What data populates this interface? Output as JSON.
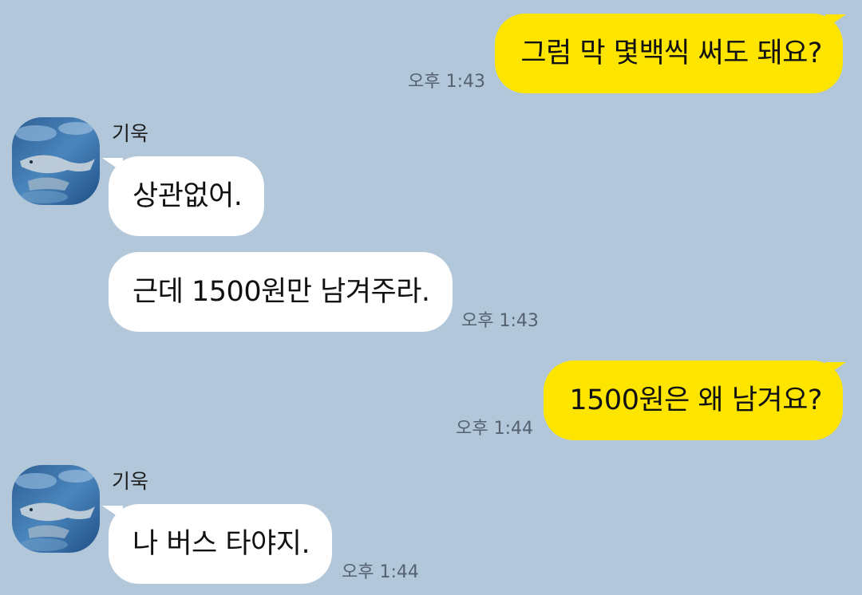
{
  "conversation": {
    "messages": [
      {
        "text": "그럼 막 몇백씩 써도 돼요?",
        "time": "오후 1:43"
      },
      {
        "sender": "기욱",
        "text": "상관없어."
      },
      {
        "text": "근데 1500원만 남겨주라.",
        "time": "오후 1:43"
      },
      {
        "text": "1500원은 왜 남겨요?",
        "time": "오후 1:44"
      },
      {
        "sender": "기욱",
        "text": "나 버스 타야지.",
        "time": "오후 1:44"
      }
    ]
  },
  "colors": {
    "background": "#b2c7d9",
    "outgoing_bubble": "#fee500",
    "incoming_bubble": "#ffffff",
    "timestamp": "#556270"
  },
  "icons": {
    "avatar": "shark-photo-avatar-icon"
  }
}
